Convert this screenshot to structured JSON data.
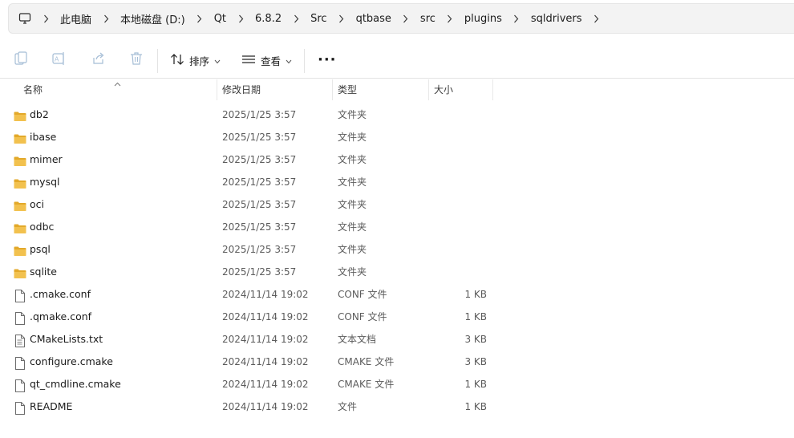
{
  "address_bar": {
    "crumbs": [
      "此电脑",
      "本地磁盘 (D:)",
      "Qt",
      "6.8.2",
      "Src",
      "qtbase",
      "src",
      "plugins",
      "sqldrivers"
    ]
  },
  "toolbar": {
    "sort_label": "排序",
    "view_label": "查看",
    "more_label": "···"
  },
  "columns": {
    "name": "名称",
    "date": "修改日期",
    "type": "类型",
    "size": "大小"
  },
  "files": [
    {
      "name": "db2",
      "date": "2025/1/25 3:57",
      "type": "文件夹",
      "size": "",
      "kind": "folder"
    },
    {
      "name": "ibase",
      "date": "2025/1/25 3:57",
      "type": "文件夹",
      "size": "",
      "kind": "folder"
    },
    {
      "name": "mimer",
      "date": "2025/1/25 3:57",
      "type": "文件夹",
      "size": "",
      "kind": "folder"
    },
    {
      "name": "mysql",
      "date": "2025/1/25 3:57",
      "type": "文件夹",
      "size": "",
      "kind": "folder"
    },
    {
      "name": "oci",
      "date": "2025/1/25 3:57",
      "type": "文件夹",
      "size": "",
      "kind": "folder"
    },
    {
      "name": "odbc",
      "date": "2025/1/25 3:57",
      "type": "文件夹",
      "size": "",
      "kind": "folder"
    },
    {
      "name": "psql",
      "date": "2025/1/25 3:57",
      "type": "文件夹",
      "size": "",
      "kind": "folder"
    },
    {
      "name": "sqlite",
      "date": "2025/1/25 3:57",
      "type": "文件夹",
      "size": "",
      "kind": "folder"
    },
    {
      "name": ".cmake.conf",
      "date": "2024/11/14 19:02",
      "type": "CONF 文件",
      "size": "1 KB",
      "kind": "file"
    },
    {
      "name": ".qmake.conf",
      "date": "2024/11/14 19:02",
      "type": "CONF 文件",
      "size": "1 KB",
      "kind": "file"
    },
    {
      "name": "CMakeLists.txt",
      "date": "2024/11/14 19:02",
      "type": "文本文档",
      "size": "3 KB",
      "kind": "text"
    },
    {
      "name": "configure.cmake",
      "date": "2024/11/14 19:02",
      "type": "CMAKE 文件",
      "size": "3 KB",
      "kind": "file"
    },
    {
      "name": "qt_cmdline.cmake",
      "date": "2024/11/14 19:02",
      "type": "CMAKE 文件",
      "size": "1 KB",
      "kind": "file"
    },
    {
      "name": "README",
      "date": "2024/11/14 19:02",
      "type": "文件",
      "size": "1 KB",
      "kind": "file"
    }
  ],
  "colors": {
    "folder": "#f2c14e",
    "folder_dark": "#e3a92a",
    "accent": "#005fb8"
  }
}
